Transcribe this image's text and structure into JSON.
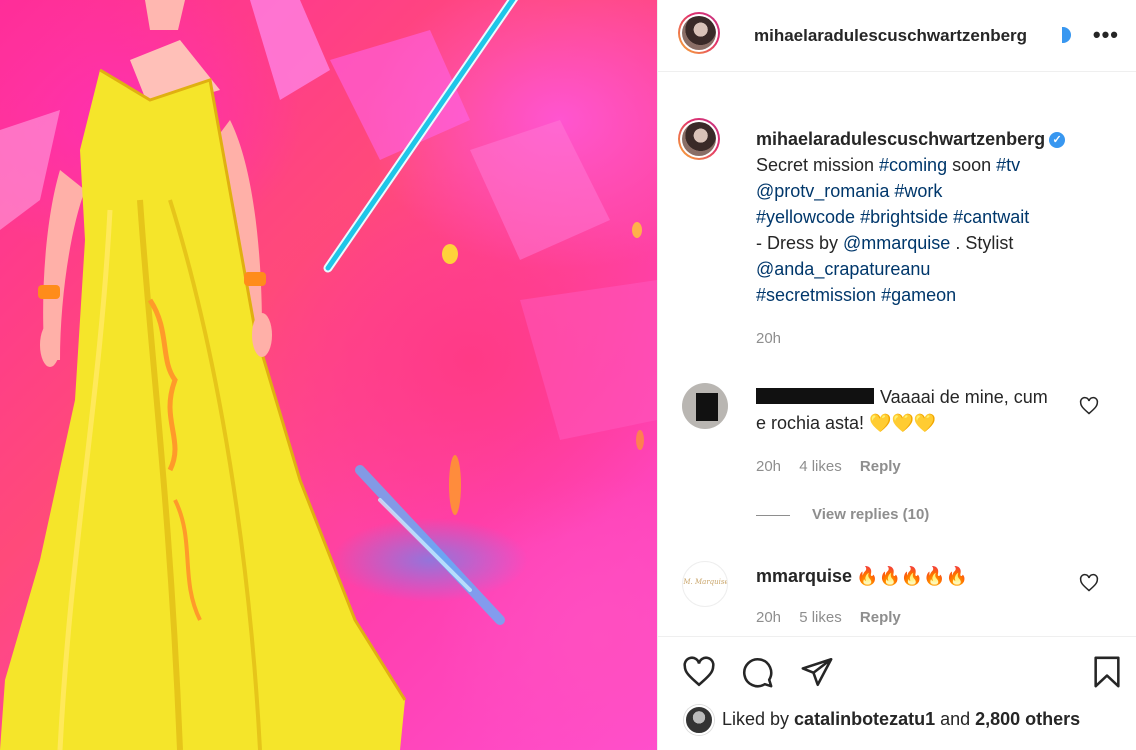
{
  "post": {
    "username": "mihaelaradulescuschwartzenberg",
    "verified_icon": "verified-badge-icon",
    "more_icon": "•••"
  },
  "caption": {
    "username": "mihaelaradulescuschwartzenberg",
    "parts": {
      "p1": "Secret mission ",
      "t1": "#coming",
      "p2": " soon ",
      "t2": "#tv",
      "t3": "@protv_romania",
      "t4": "#work",
      "t5": "#yellowcode",
      "t6": "#brightside",
      "t7": "#cantwait",
      "p3": " - Dress by ",
      "t8": "@mmarquise",
      "p4": " . Stylist ",
      "t9": "@anda_crapatureanu",
      "t10": "#secretmission",
      "t11": "#gameon"
    },
    "time": "20h"
  },
  "comments": [
    {
      "username_redacted": true,
      "text": "Vaaaai de mine, cum e rochia asta! 💛💛💛",
      "time": "20h",
      "likes": "4 likes",
      "reply": "Reply",
      "view_replies": "View replies (10)"
    },
    {
      "username": "mmarquise",
      "text": "🔥🔥🔥🔥🔥",
      "avatar_text": "M. Marquise",
      "time": "20h",
      "likes": "5 likes",
      "reply": "Reply"
    }
  ],
  "likes_summary": {
    "prefix": "Liked by ",
    "user": "catalinbotezatu1",
    "middle": " and ",
    "others": "2,800 others"
  },
  "colors": {
    "hashtag": "#00376b",
    "muted": "#8e8e8e",
    "verified": "#3897f0",
    "dress": "#f5e52a",
    "background_pink": "#ff3fae"
  },
  "icons": [
    "heart-icon",
    "comment-icon",
    "share-icon",
    "bookmark-icon",
    "more-options-icon"
  ]
}
